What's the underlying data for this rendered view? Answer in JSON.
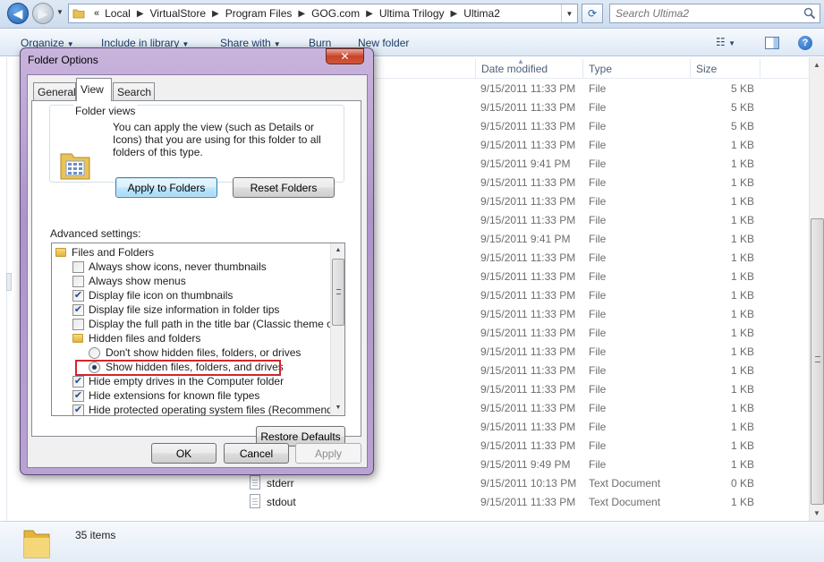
{
  "explorer": {
    "address": {
      "overflow": "«",
      "crumbs": [
        "Local",
        "VirtualStore",
        "Program Files",
        "GOG.com",
        "Ultima Trilogy",
        "Ultima2"
      ]
    },
    "search_placeholder": "Search Ultima2",
    "toolbar": {
      "organize": "Organize",
      "include": "Include in library",
      "share": "Share with",
      "burn": "Burn",
      "new_folder": "New folder"
    },
    "columns": {
      "date": "Date modified",
      "type": "Type",
      "size": "Size"
    },
    "files": [
      {
        "name": "",
        "date": "9/15/2011 11:33 PM",
        "type": "File",
        "size": "5 KB"
      },
      {
        "name": "",
        "date": "9/15/2011 11:33 PM",
        "type": "File",
        "size": "5 KB"
      },
      {
        "name": "",
        "date": "9/15/2011 11:33 PM",
        "type": "File",
        "size": "5 KB"
      },
      {
        "name": "",
        "date": "9/15/2011 11:33 PM",
        "type": "File",
        "size": "1 KB"
      },
      {
        "name": "",
        "date": "9/15/2011 9:41 PM",
        "type": "File",
        "size": "1 KB"
      },
      {
        "name": "",
        "date": "9/15/2011 11:33 PM",
        "type": "File",
        "size": "1 KB"
      },
      {
        "name": "",
        "date": "9/15/2011 11:33 PM",
        "type": "File",
        "size": "1 KB"
      },
      {
        "name": "",
        "date": "9/15/2011 11:33 PM",
        "type": "File",
        "size": "1 KB"
      },
      {
        "name": "",
        "date": "9/15/2011 9:41 PM",
        "type": "File",
        "size": "1 KB"
      },
      {
        "name": "",
        "date": "9/15/2011 11:33 PM",
        "type": "File",
        "size": "1 KB"
      },
      {
        "name": "",
        "date": "9/15/2011 11:33 PM",
        "type": "File",
        "size": "1 KB"
      },
      {
        "name": "",
        "date": "9/15/2011 11:33 PM",
        "type": "File",
        "size": "1 KB"
      },
      {
        "name": "",
        "date": "9/15/2011 11:33 PM",
        "type": "File",
        "size": "1 KB"
      },
      {
        "name": "",
        "date": "9/15/2011 11:33 PM",
        "type": "File",
        "size": "1 KB"
      },
      {
        "name": "",
        "date": "9/15/2011 11:33 PM",
        "type": "File",
        "size": "1 KB"
      },
      {
        "name": "",
        "date": "9/15/2011 11:33 PM",
        "type": "File",
        "size": "1 KB"
      },
      {
        "name": "",
        "date": "9/15/2011 11:33 PM",
        "type": "File",
        "size": "1 KB"
      },
      {
        "name": "",
        "date": "9/15/2011 11:33 PM",
        "type": "File",
        "size": "1 KB"
      },
      {
        "name": "",
        "date": "9/15/2011 11:33 PM",
        "type": "File",
        "size": "1 KB"
      },
      {
        "name": "",
        "date": "9/15/2011 11:33 PM",
        "type": "File",
        "size": "1 KB"
      },
      {
        "name": "",
        "date": "9/15/2011 9:49 PM",
        "type": "File",
        "size": "1 KB"
      },
      {
        "name": "stderr",
        "date": "9/15/2011 10:13 PM",
        "type": "Text Document",
        "size": "0 KB"
      },
      {
        "name": "stdout",
        "date": "9/15/2011 11:33 PM",
        "type": "Text Document",
        "size": "1 KB"
      }
    ],
    "status": {
      "item_count": "35 items"
    }
  },
  "dialog": {
    "title": "Folder Options",
    "tabs": {
      "general": "General",
      "view": "View",
      "search": "Search"
    },
    "folder_views": {
      "legend": "Folder views",
      "description": "You can apply the view (such as Details or Icons) that you are using for this folder to all folders of this type.",
      "apply_button": "Apply to Folders",
      "reset_button": "Reset Folders"
    },
    "advanced": {
      "label": "Advanced settings:",
      "items": [
        {
          "kind": "folder",
          "label": "Files and Folders"
        },
        {
          "kind": "checkbox",
          "checked": false,
          "label": "Always show icons, never thumbnails"
        },
        {
          "kind": "checkbox",
          "checked": false,
          "label": "Always show menus"
        },
        {
          "kind": "checkbox",
          "checked": true,
          "label": "Display file icon on thumbnails"
        },
        {
          "kind": "checkbox",
          "checked": true,
          "label": "Display file size information in folder tips"
        },
        {
          "kind": "checkbox",
          "checked": false,
          "label": "Display the full path in the title bar (Classic theme only)"
        },
        {
          "kind": "folder",
          "label": "Hidden files and folders"
        },
        {
          "kind": "radio",
          "checked": false,
          "label": "Don't show hidden files, folders, or drives"
        },
        {
          "kind": "radio",
          "checked": true,
          "label": "Show hidden files, folders, and drives"
        },
        {
          "kind": "checkbox",
          "checked": true,
          "label": "Hide empty drives in the Computer folder"
        },
        {
          "kind": "checkbox",
          "checked": true,
          "label": "Hide extensions for known file types"
        },
        {
          "kind": "checkbox",
          "checked": true,
          "label": "Hide protected operating system files (Recommended)"
        }
      ],
      "restore_button": "Restore Defaults"
    },
    "buttons": {
      "ok": "OK",
      "cancel": "Cancel",
      "apply": "Apply"
    },
    "highlight_color": "#d2262a"
  }
}
